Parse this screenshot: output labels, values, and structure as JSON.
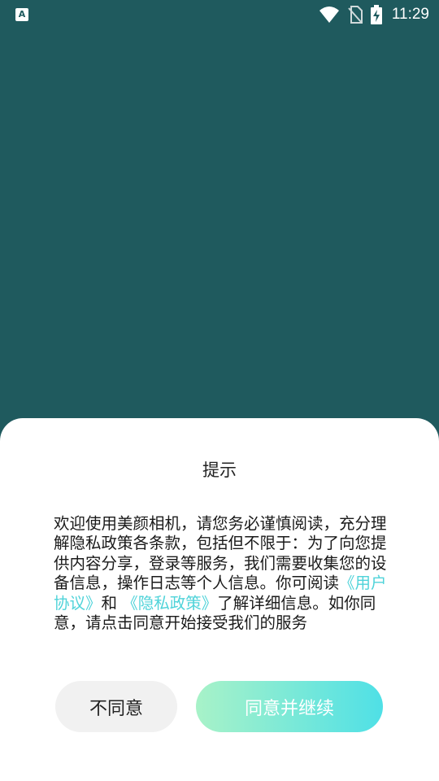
{
  "status_bar": {
    "app_icon": "accessibility-app-icon",
    "time": "11:29",
    "icons": [
      "wifi-icon",
      "no-sim-icon",
      "battery-charging-icon"
    ]
  },
  "dialog": {
    "title": "提示",
    "body": {
      "intro": "欢迎使用美颜相机，请您务必谨慎阅读，充分理解隐私政策各条款，包括但不限于：为了向您提供内容分享，登录等服务，我们需要收集您的设备信息，操作日志等个人信息。你可阅读",
      "user_agreement_link": "《用户协议》",
      "and": "和",
      "privacy_policy_link": "《隐私政策》",
      "outro": "了解详细信息。如你同意，请点击同意开始接受我们的服务"
    },
    "decline_label": "不同意",
    "accept_label": "同意并继续"
  },
  "colors": {
    "background": "#1f5a5e",
    "link": "#4fd3d9",
    "accept_gradient_start": "#a8f2c8",
    "accept_gradient_end": "#4fe0e6"
  }
}
